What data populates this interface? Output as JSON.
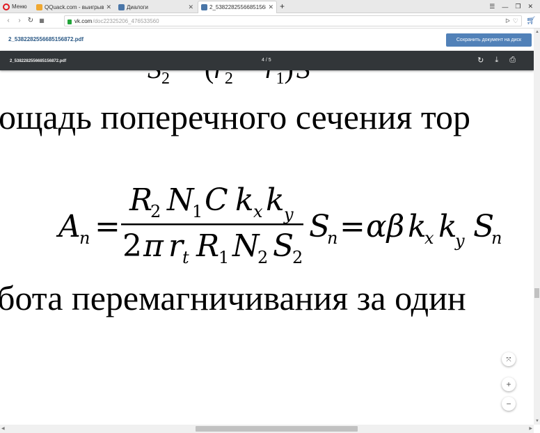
{
  "browser": {
    "menu_label": "Меню",
    "tabs": [
      {
        "title": "QQuack.com - выигрывай",
        "icon_color": "#f0a830",
        "active": false
      },
      {
        "title": "Диалоги",
        "icon_color": "#4a76a8",
        "active": false
      },
      {
        "title": "2_5382282556685156872.pdf",
        "icon_color": "#4a76a8",
        "active": true
      }
    ],
    "new_tab_icon": "plus-icon",
    "url_host": "vk.com",
    "url_path": "/doc22325206_476533560"
  },
  "vk_doc": {
    "file_link": "2_5382282556685156872.pdf",
    "save_button": "Сохранить документ на диск",
    "accent_color": "#5181b8"
  },
  "pdf_viewer": {
    "file_name": "2_5382282556685156872.pdf",
    "page_indicator": "4 / 5"
  },
  "document": {
    "line_area": "ощадь поперечного сечения тор",
    "line_work": "бота перемагничивания за один",
    "formula": {
      "lhs": "A",
      "lhs_sub": "n",
      "numerator": "R₂N₁C kₓk_y",
      "denominator": "2πr_t R₁N₂S₂",
      "rhs": "S_n=αβ kₓk_y S_n"
    }
  }
}
